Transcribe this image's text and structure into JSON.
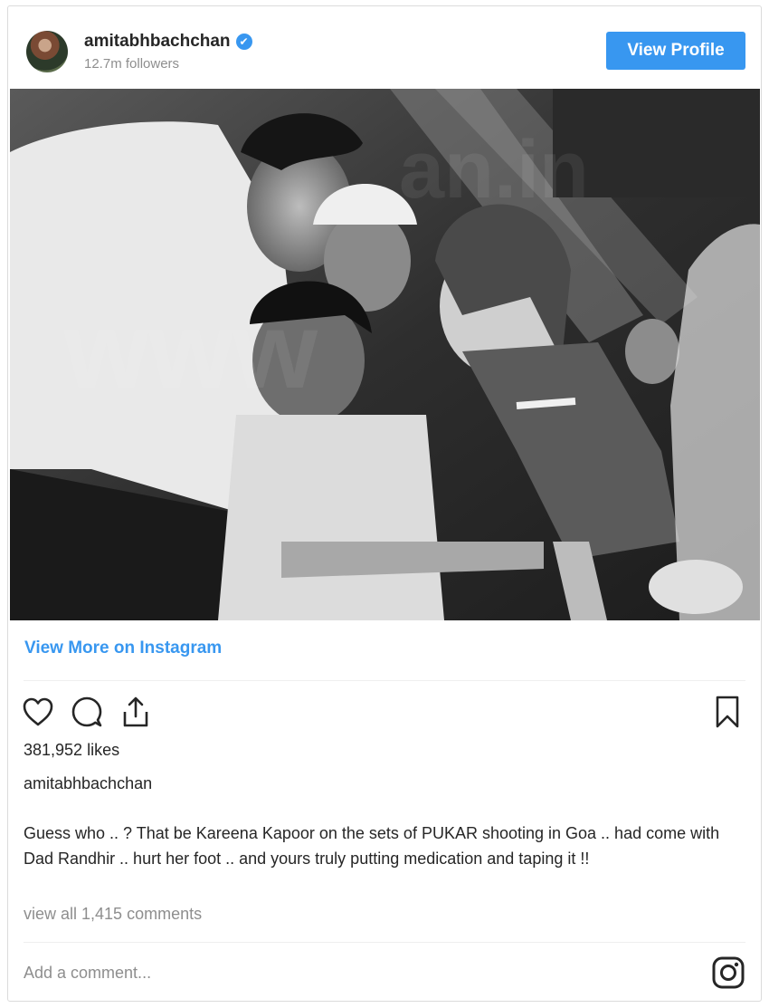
{
  "header": {
    "username": "amitabhbachchan",
    "verified_mark": "✔",
    "followers": "12.7m followers",
    "view_profile_label": "View Profile"
  },
  "post": {
    "view_more_label": "View More on Instagram",
    "likes": "381,952 likes",
    "owner": "amitabhbachchan",
    "caption": "Guess who .. ? That be Kareena Kapoor on the sets of PUKAR shooting in Goa .. had come with Dad Randhir .. hurt her foot .. and yours truly putting medication and taping it !!",
    "view_comments": "view all 1,415 comments",
    "add_comment_placeholder": "Add a comment..."
  },
  "icons": {
    "like": "heart-icon",
    "comment": "comment-bubble-icon",
    "share": "share-icon",
    "save": "bookmark-icon",
    "instagram": "instagram-logo-icon",
    "verified": "verified-badge-icon"
  },
  "colors": {
    "accent": "#3897f0",
    "text": "#262626",
    "muted": "#8e8e8e",
    "border": "#dbdbdb"
  }
}
